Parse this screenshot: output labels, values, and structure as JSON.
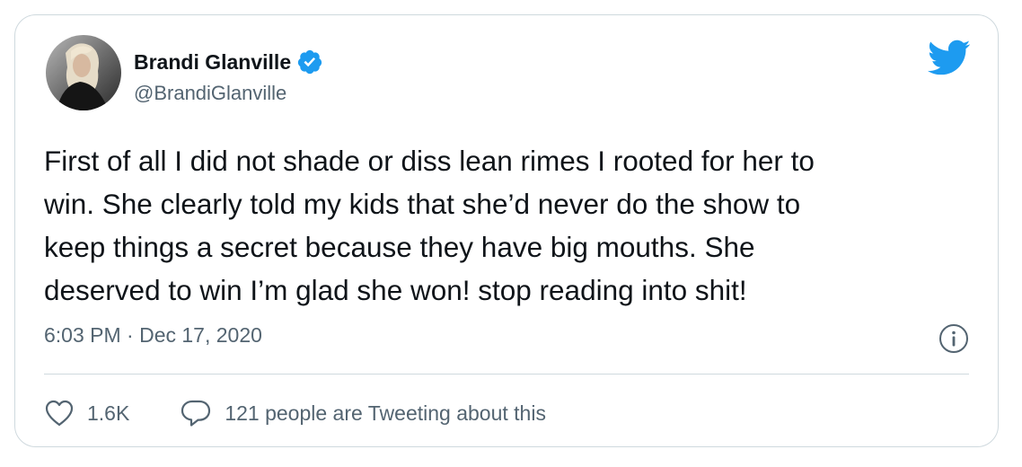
{
  "colors": {
    "accent": "#1d9bf0",
    "text_primary": "#0f1419",
    "text_secondary": "#536471",
    "border": "#cfd9de"
  },
  "author": {
    "display_name": "Brandi Glanville",
    "handle": "@BrandiGlanville",
    "verified": true,
    "verified_icon": "verified-badge-icon"
  },
  "brand_icon": "twitter-bird-icon",
  "tweet": {
    "text": "First of all I did not shade or diss lean rimes I rooted for her to\nwin. She clearly told my kids that she’d never do the show to\nkeep things a secret because they have big mouths. She\ndeserved to win I’m glad she won! stop reading into shit!",
    "timestamp": "6:03 PM · Dec 17, 2020"
  },
  "actions": {
    "like_icon": "heart-icon",
    "like_count": "1.6K",
    "reply_icon": "speech-bubble-icon",
    "conversation_label": "121 people are Tweeting about this"
  },
  "info_icon": "info-icon"
}
